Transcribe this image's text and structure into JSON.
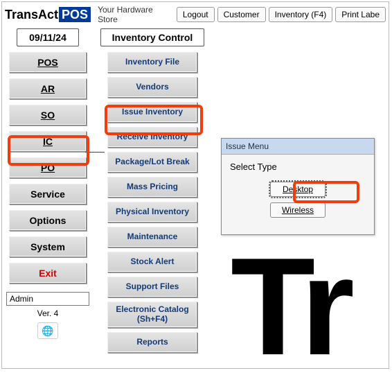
{
  "logo": {
    "part1": "Trans",
    "part2": "Act",
    "part3": "POS"
  },
  "store_name": "Your Hardware Store",
  "top_buttons": {
    "logout": "Logout",
    "customer": "Customer",
    "inventory": "Inventory (F4)",
    "print": "Print Labe"
  },
  "date": "09/11/24",
  "nav": {
    "pos": "POS",
    "ar": "AR",
    "so": "SO",
    "ic": "IC",
    "po": "PO",
    "service": "Service",
    "options": "Options",
    "system": "System",
    "exit": "Exit"
  },
  "mid_header": "Inventory Control",
  "mid": {
    "invfile": "Inventory File",
    "vendors": "Vendors",
    "issue": "Issue Inventory",
    "receive": "Receive Inventory",
    "package": "Package/Lot Break",
    "mass": "Mass Pricing",
    "physical": "Physical Inventory",
    "maint": "Maintenance",
    "stock": "Stock Alert",
    "support": "Support Files",
    "ecat": "Electronic Catalog (Sh+F4)",
    "reports": "Reports"
  },
  "dialog": {
    "title": "Issue Menu",
    "prompt": "Select Type",
    "desktop": "Desktop",
    "wireless": "Wireless"
  },
  "admin_value": "Admin",
  "version": "Ver. 4",
  "big_text": "Tr"
}
